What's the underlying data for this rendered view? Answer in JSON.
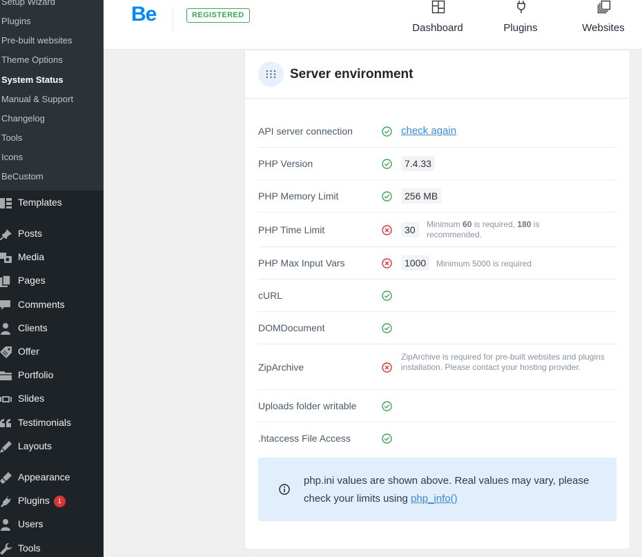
{
  "sidebar": {
    "submenu": [
      {
        "label": "Setup Wizard",
        "current": false
      },
      {
        "label": "Plugins",
        "current": false
      },
      {
        "label": "Pre-built websites",
        "current": false
      },
      {
        "label": "Theme Options",
        "current": false
      },
      {
        "label": "System Status",
        "current": true
      },
      {
        "label": "Manual & Support",
        "current": false
      },
      {
        "label": "Changelog",
        "current": false
      },
      {
        "label": "Tools",
        "current": false
      },
      {
        "label": "Icons",
        "current": false
      },
      {
        "label": "BeCustom",
        "current": false
      }
    ],
    "menu": [
      {
        "label": "Templates",
        "icon": "templates-icon"
      },
      {
        "label": "Posts",
        "icon": "pin-icon"
      },
      {
        "label": "Media",
        "icon": "media-icon"
      },
      {
        "label": "Pages",
        "icon": "pages-icon"
      },
      {
        "label": "Comments",
        "icon": "comments-icon"
      },
      {
        "label": "Clients",
        "icon": "person-icon"
      },
      {
        "label": "Offer",
        "icon": "tag-icon"
      },
      {
        "label": "Portfolio",
        "icon": "folder-icon"
      },
      {
        "label": "Slides",
        "icon": "slides-icon"
      },
      {
        "label": "Testimonials",
        "icon": "quote-icon"
      },
      {
        "label": "Layouts",
        "icon": "brush-icon"
      },
      {
        "label": "Appearance",
        "icon": "appearance-icon"
      },
      {
        "label": "Plugins",
        "icon": "plug-icon",
        "badge": "1"
      },
      {
        "label": "Users",
        "icon": "person-icon"
      },
      {
        "label": "Tools",
        "icon": "wrench-icon"
      }
    ]
  },
  "header": {
    "logo": "Be",
    "registered_label": "REGISTERED",
    "nav": [
      {
        "label": "Dashboard",
        "icon": "dashboard-icon"
      },
      {
        "label": "Plugins",
        "icon": "plug-icon"
      },
      {
        "label": "Websites",
        "icon": "websites-icon"
      }
    ]
  },
  "panel": {
    "title": "Server environment",
    "rows": [
      {
        "label": "API server connection",
        "status": "ok",
        "link": "check again"
      },
      {
        "label": "PHP Version",
        "status": "ok",
        "value": "7.4.33"
      },
      {
        "label": "PHP Memory Limit",
        "status": "ok",
        "value": "256 MB"
      },
      {
        "label": "PHP Time Limit",
        "status": "error",
        "value": "30",
        "note_parts": [
          "Minimum ",
          "60",
          " is required, ",
          "180",
          " is recommended."
        ]
      },
      {
        "label": "PHP Max Input Vars",
        "status": "error",
        "value": "1000",
        "note": "Minimum 5000 is required"
      },
      {
        "label": "cURL",
        "status": "ok"
      },
      {
        "label": "DOMDocument",
        "status": "ok"
      },
      {
        "label": "ZipArchive",
        "status": "error",
        "note": "ZipArchive is required for pre-built websites and plugins installation. Please contact your hosting provider."
      },
      {
        "label": "Uploads folder writable",
        "status": "ok"
      },
      {
        "label": ".htaccess File Access",
        "status": "ok"
      }
    ],
    "info": {
      "text": "php.ini values are shown above. Real values may vary, please check your limits using ",
      "link": "php_info()"
    }
  },
  "colors": {
    "ok": "#3fa45a",
    "error": "#d63638",
    "accent": "#0089f7",
    "link": "#3b8ad9"
  }
}
